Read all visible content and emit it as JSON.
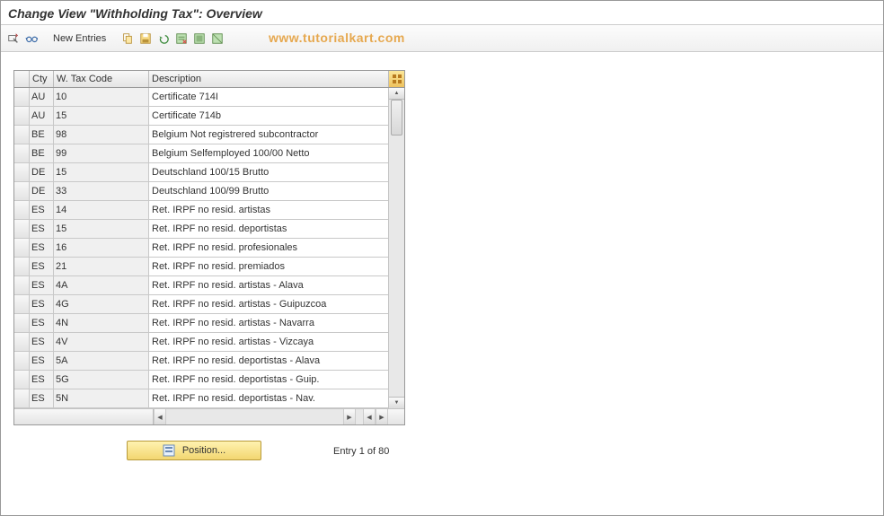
{
  "title": "Change View \"Withholding Tax\": Overview",
  "watermark": "www.tutorialkart.com",
  "toolbar": {
    "details_icon": "details-magnifier",
    "find_icon": "glasses",
    "new_entries_label": "New Entries",
    "copy_icon": "copy",
    "save_icon": "save-floppy",
    "undo_icon": "undo",
    "delete_icon": "delete-row",
    "select_all_icon": "select-all",
    "deselect_icon": "deselect-all"
  },
  "columns": {
    "cty": "Cty",
    "code": "W. Tax Code",
    "desc": "Description"
  },
  "rows": [
    {
      "cty": "AU",
      "code": "10",
      "desc": "Certificate 714I"
    },
    {
      "cty": "AU",
      "code": "15",
      "desc": "Certificate 714b"
    },
    {
      "cty": "BE",
      "code": "98",
      "desc": "Belgium Not registrered subcontractor"
    },
    {
      "cty": "BE",
      "code": "99",
      "desc": "Belgium Selfemployed 100/00 Netto"
    },
    {
      "cty": "DE",
      "code": "15",
      "desc": "Deutschland 100/15 Brutto"
    },
    {
      "cty": "DE",
      "code": "33",
      "desc": "Deutschland 100/99 Brutto"
    },
    {
      "cty": "ES",
      "code": "14",
      "desc": "Ret. IRPF no resid. artistas"
    },
    {
      "cty": "ES",
      "code": "15",
      "desc": "Ret. IRPF no resid. deportistas"
    },
    {
      "cty": "ES",
      "code": "16",
      "desc": "Ret. IRPF no resid. profesionales"
    },
    {
      "cty": "ES",
      "code": "21",
      "desc": "Ret. IRPF no resid. premiados"
    },
    {
      "cty": "ES",
      "code": "4A",
      "desc": "Ret. IRPF no resid. artistas - Alava"
    },
    {
      "cty": "ES",
      "code": "4G",
      "desc": "Ret. IRPF no resid. artistas - Guipuzcoa"
    },
    {
      "cty": "ES",
      "code": "4N",
      "desc": "Ret. IRPF no resid. artistas - Navarra"
    },
    {
      "cty": "ES",
      "code": "4V",
      "desc": "Ret. IRPF no resid. artistas - Vizcaya"
    },
    {
      "cty": "ES",
      "code": "5A",
      "desc": "Ret. IRPF no resid. deportistas - Alava"
    },
    {
      "cty": "ES",
      "code": "5G",
      "desc": "Ret. IRPF no resid. deportistas - Guip."
    },
    {
      "cty": "ES",
      "code": "5N",
      "desc": "Ret. IRPF no resid. deportistas - Nav."
    }
  ],
  "footer": {
    "position_label": "Position...",
    "entry_text": "Entry 1 of 80"
  }
}
